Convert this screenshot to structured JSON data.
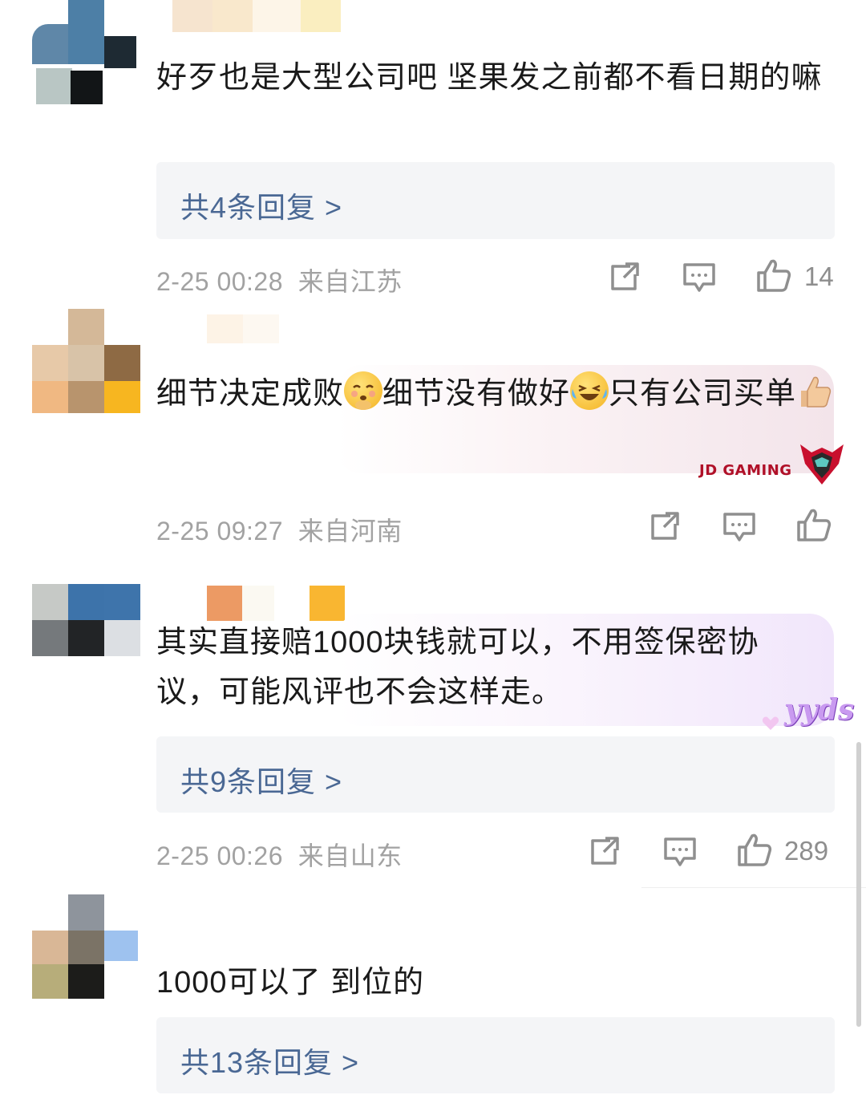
{
  "comments": [
    {
      "text": "好歹也是大型公司吧 坚果发之前都不看日期的嘛",
      "replies": "共4条回复 >",
      "time": "2-25 00:28",
      "location": "来自江苏",
      "likes": "14"
    },
    {
      "text_parts": [
        "细节决定成败",
        "细节没有做好",
        "只有公司买单"
      ],
      "time": "2-25 09:27",
      "location": "来自河南",
      "likes": "",
      "badge": "JD GAMING"
    },
    {
      "text": "其实直接赔1000块钱就可以，不用签保密协议，可能风评也不会这样走。",
      "replies": "共9条回复 >",
      "time": "2-25 00:26",
      "location": "来自山东",
      "likes": "289",
      "badge": "yyds"
    },
    {
      "text": "1000可以了 到位的",
      "replies": "共13条回复 >"
    }
  ],
  "icons": {
    "share": "share-icon",
    "comment": "comment-icon",
    "like": "thumbs-up-icon",
    "emoji_blush": "blushing-face-emoji",
    "emoji_laugh": "crying-laughing-face-emoji",
    "emoji_thumb": "thumbs-up-emoji"
  },
  "colors": {
    "reply_link": "#4a6894",
    "meta_text": "#a2a2a2",
    "reply_box": "#f4f5f7",
    "jd_red": "#c8102e"
  }
}
